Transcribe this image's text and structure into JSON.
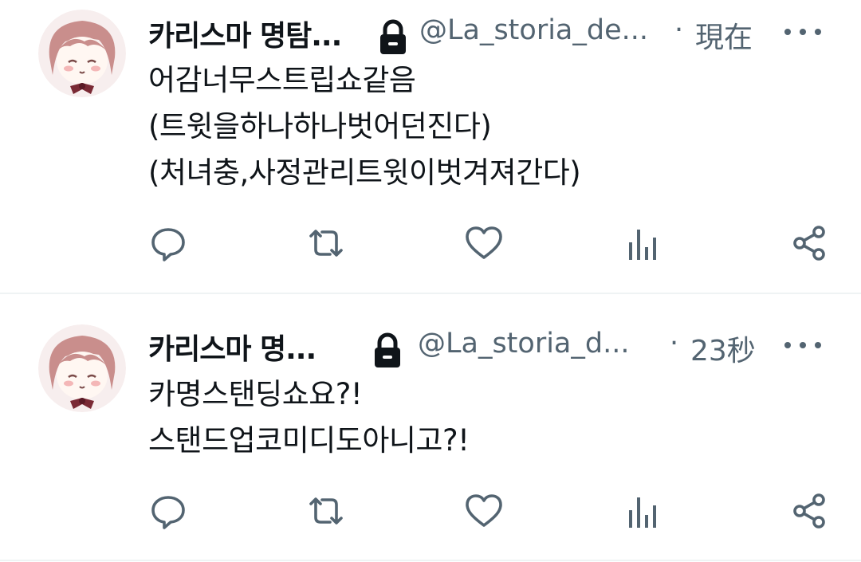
{
  "tweets": [
    {
      "display_name": "카리스마 명탐...",
      "handle": "@La_storia_de...",
      "separator": "·",
      "time": "現在",
      "text_lines": [
        "어감너무스트립쇼같음",
        "(트윗을하나하나벗어던진다)",
        "(처녀충,사정관리트윗이벗겨져간다)"
      ]
    },
    {
      "display_name": "카리스마 명...",
      "handle": "@La_storia_d...",
      "separator": "·",
      "time": "23秒",
      "text_lines": [
        "카명스탠딩쇼요?!",
        "스탠드업코미디도아니고?!"
      ]
    }
  ],
  "icons": {
    "avatar": "anime-avatar",
    "lock": "lock-icon",
    "more": "more-icon",
    "reply": "reply-icon",
    "retweet": "retweet-icon",
    "like": "like-icon",
    "views": "views-icon",
    "share": "share-icon"
  },
  "colors": {
    "text": "#0f1419",
    "secondary": "#536471",
    "divider": "#eff3f4"
  }
}
